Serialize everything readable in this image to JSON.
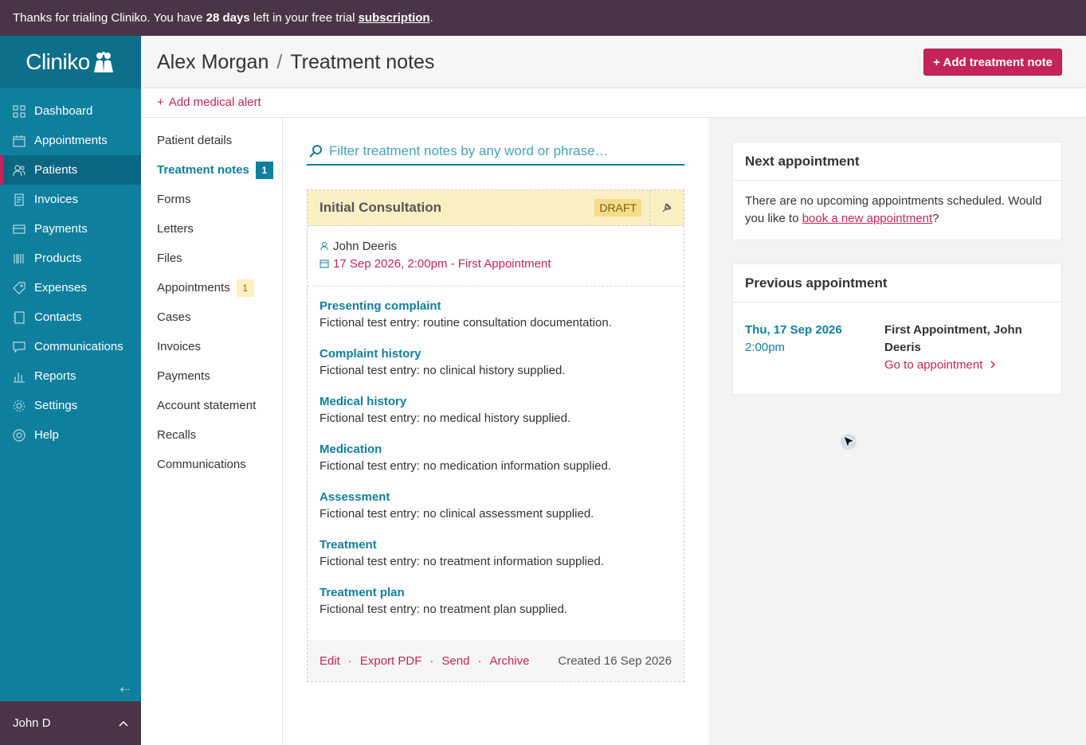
{
  "trial_banner": {
    "prefix": "Thanks for trialing Cliniko. You have ",
    "days": "28 days",
    "middle": " left in your free trial ",
    "link": "subscription",
    "suffix": "."
  },
  "app": {
    "logo": "Cliniko"
  },
  "sidebar": {
    "items": [
      {
        "label": "Dashboard",
        "icon": "dashboard-icon"
      },
      {
        "label": "Appointments",
        "icon": "calendar-icon"
      },
      {
        "label": "Patients",
        "icon": "patients-icon",
        "active": true
      },
      {
        "label": "Invoices",
        "icon": "invoice-icon"
      },
      {
        "label": "Payments",
        "icon": "card-icon"
      },
      {
        "label": "Products",
        "icon": "barcode-icon"
      },
      {
        "label": "Expenses",
        "icon": "tag-icon"
      },
      {
        "label": "Contacts",
        "icon": "contacts-icon"
      },
      {
        "label": "Communications",
        "icon": "chat-icon"
      },
      {
        "label": "Reports",
        "icon": "chart-icon"
      },
      {
        "label": "Settings",
        "icon": "gear-icon"
      },
      {
        "label": "Help",
        "icon": "help-icon"
      }
    ],
    "user": "John D"
  },
  "header": {
    "patient": "Alex Morgan",
    "separator": "/",
    "page": "Treatment notes",
    "add_button": "+ Add treatment note"
  },
  "alert": {
    "add_label": "Add medical alert"
  },
  "subnav": {
    "items": [
      {
        "label": "Patient details"
      },
      {
        "label": "Treatment notes",
        "badge": "1",
        "active": true
      },
      {
        "label": "Forms"
      },
      {
        "label": "Letters"
      },
      {
        "label": "Files"
      },
      {
        "label": "Appointments",
        "badge": "1"
      },
      {
        "label": "Cases"
      },
      {
        "label": "Invoices"
      },
      {
        "label": "Payments"
      },
      {
        "label": "Account statement"
      },
      {
        "label": "Recalls"
      },
      {
        "label": "Communications"
      }
    ]
  },
  "filter": {
    "placeholder": "Filter treatment notes by any word or phrase…"
  },
  "note": {
    "title": "Initial Consultation",
    "status": "DRAFT",
    "practitioner": "John Deeris",
    "appointment": "17 Sep 2026, 2:00pm - First Appointment",
    "sections": [
      {
        "title": "Presenting complaint",
        "text": "Fictional test entry: routine consultation documentation."
      },
      {
        "title": "Complaint history",
        "text": "Fictional test entry: no clinical history supplied."
      },
      {
        "title": "Medical history",
        "text": "Fictional test entry: no medical history supplied."
      },
      {
        "title": "Medication",
        "text": "Fictional test entry: no medication information supplied."
      },
      {
        "title": "Assessment",
        "text": "Fictional test entry: no clinical assessment supplied."
      },
      {
        "title": "Treatment",
        "text": "Fictional test entry: no treatment information supplied."
      },
      {
        "title": "Treatment plan",
        "text": "Fictional test entry: no treatment plan supplied."
      }
    ],
    "actions": {
      "edit": "Edit",
      "export": "Export PDF",
      "send": "Send",
      "archive": "Archive",
      "separator": "·"
    },
    "created": "Created 16 Sep 2026"
  },
  "next_appointment": {
    "heading": "Next appointment",
    "text_before": "There are no upcoming appointments scheduled. Would you like to ",
    "link": "book a new appointment",
    "text_after": "?"
  },
  "previous_appointment": {
    "heading": "Previous appointment",
    "date": "Thu, 17 Sep 2026",
    "time": "2:00pm",
    "description": "First Appointment, John Deeris",
    "goto": "Go to appointment"
  },
  "colors": {
    "primary": "#0f7f9e",
    "accent": "#c4245a",
    "banner": "#4a3548",
    "draft": "#fbefc4"
  }
}
